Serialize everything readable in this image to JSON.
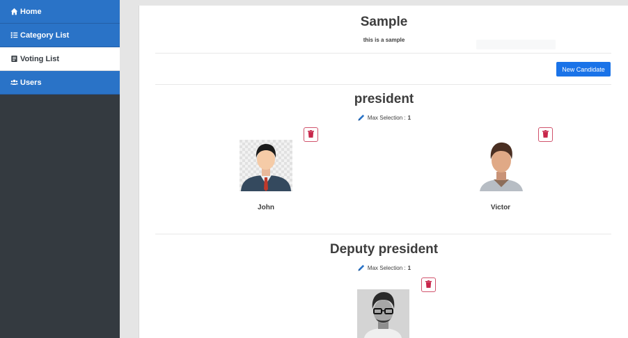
{
  "sidebar": {
    "items": [
      {
        "label": "Home",
        "icon": "home-icon",
        "active": false
      },
      {
        "label": "Category List",
        "icon": "list-icon",
        "active": false
      },
      {
        "label": "Voting List",
        "icon": "ballot-icon",
        "active": true
      },
      {
        "label": "Users",
        "icon": "users-icon",
        "active": false
      }
    ]
  },
  "header": {
    "title": "Sample",
    "subtitle": "this is a sample"
  },
  "toolbar": {
    "new_candidate_label": "New Candidate"
  },
  "categories": [
    {
      "title": "president",
      "max_selection_label": "Max Selection :",
      "max_selection_value": "1",
      "candidates": [
        {
          "name": "John"
        },
        {
          "name": "Victor"
        }
      ]
    },
    {
      "title": "Deputy president",
      "max_selection_label": "Max Selection :",
      "max_selection_value": "1",
      "candidates": [
        {
          "name": ""
        }
      ]
    }
  ],
  "colors": {
    "sidebar_bg": "#343a40",
    "nav_blue": "#2a73c7",
    "primary_button": "#1a73e8",
    "delete_red": "#c8264a"
  }
}
